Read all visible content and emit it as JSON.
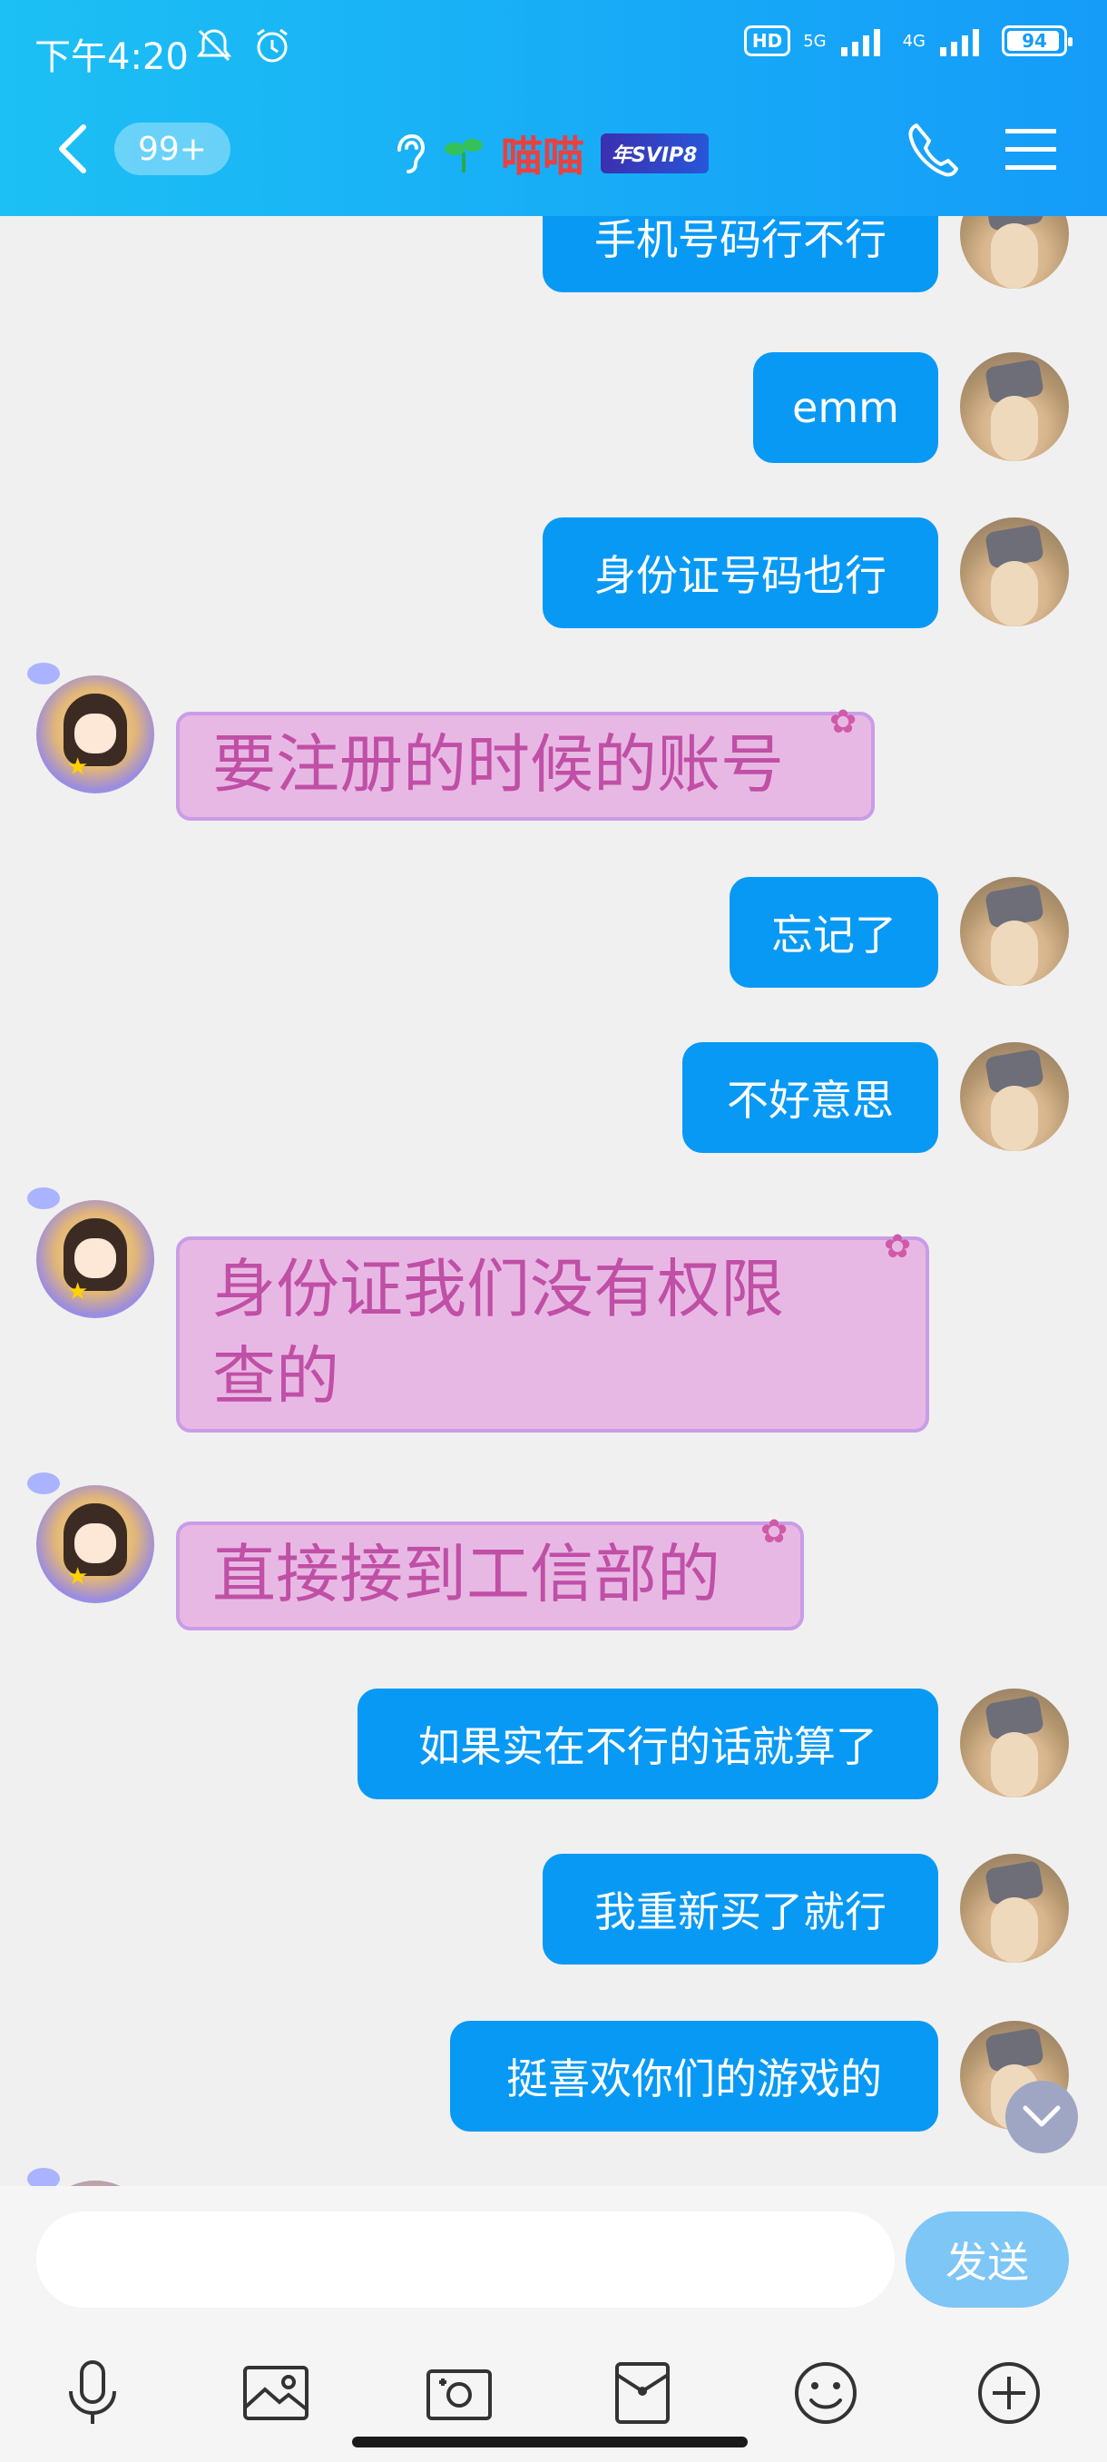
{
  "status_bar": {
    "time": "下午4:20",
    "hd": "HD",
    "net1": "5G",
    "net2": "4G",
    "battery": "94"
  },
  "header": {
    "unread_count": "99+",
    "title": "喵喵",
    "svip": "年SVIP8"
  },
  "messages": [
    {
      "side": "out",
      "text": "手机号码行不行"
    },
    {
      "side": "out",
      "text": "emm"
    },
    {
      "side": "out",
      "text": "身份证号码也行"
    },
    {
      "side": "in",
      "text": "要注册的时候的账号"
    },
    {
      "side": "out",
      "text": "忘记了"
    },
    {
      "side": "out",
      "text": "不好意思"
    },
    {
      "side": "in",
      "line1": "身份证我们没有权限",
      "line2": "查的"
    },
    {
      "side": "in",
      "text": "直接接到工信部的"
    },
    {
      "side": "out",
      "text": "如果实在不行的话就算了"
    },
    {
      "side": "out",
      "text": "我重新买了就行"
    },
    {
      "side": "out",
      "text": "挺喜欢你们的游戏的"
    }
  ],
  "input": {
    "value": "",
    "send_label": "发送"
  },
  "toolbar": {
    "items": [
      "microphone-icon",
      "image-icon",
      "camera-icon",
      "red-packet-icon",
      "emoji-icon",
      "plus-icon"
    ]
  },
  "colors": {
    "header": "#17aaf7",
    "outgoing_bubble": "#0899f5",
    "incoming_bubble": "#e8b8e4",
    "incoming_text": "#c04fa6"
  }
}
